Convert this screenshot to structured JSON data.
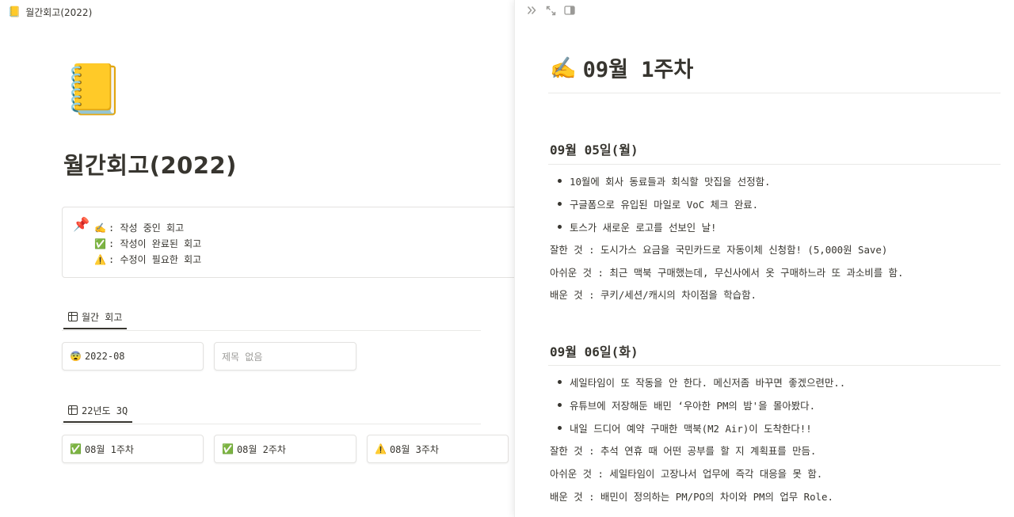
{
  "main": {
    "breadcrumb_icon": "📒",
    "breadcrumb_title": "월간회고(2022)",
    "page_icon": "📒",
    "page_title": "월간회고(2022)",
    "callout": {
      "icon": "📌",
      "legend": [
        {
          "emoji": "✍️",
          "text": ": 작성 중인 회고"
        },
        {
          "emoji": "✅",
          "text": ": 작성이 완료된 회고"
        },
        {
          "emoji": "⚠️",
          "text": ": 수정이 필요한 회고"
        }
      ]
    },
    "view1": {
      "label": "월간 회고",
      "cards": [
        {
          "emoji": "😨",
          "title": "2022-08"
        },
        {
          "emoji": "",
          "title": "제목 없음"
        }
      ]
    },
    "view2": {
      "label": "22년도 3Q",
      "cards": [
        {
          "emoji": "✅",
          "title": "08월 1주차"
        },
        {
          "emoji": "✅",
          "title": "08월 2주차"
        },
        {
          "emoji": "⚠️",
          "title": "08월 3주차"
        }
      ]
    }
  },
  "peek": {
    "toolbar_icons": [
      "double-chevron-right-icon",
      "expand-icon",
      "panel-toggle-icon"
    ],
    "title_emoji": "✍️",
    "title": "09월 1주차",
    "sections": [
      {
        "heading": "09월 05일(월)",
        "bullets": [
          "10월에 회사 동료들과 회식할 맛집을 선정함.",
          "구글폼으로 유입된 마일로 VoC 체크 완료.",
          "토스가 새로운 로고를 선보인 날!"
        ],
        "lines": [
          "잘한 것 : 도시가스 요금을 국민카드로 자동이체 신청함! (5,000원 Save)",
          "아쉬운 것 : 최근 맥북 구매했는데, 무신사에서 옷 구매하느라 또 과소비를 함.",
          "배운 것 : 쿠키/세션/캐시의 차이점을 학습함."
        ]
      },
      {
        "heading": "09월 06일(화)",
        "bullets": [
          "세일타임이 또 작동을 안 한다. 메신저좀 바꾸면 좋겠으련만..",
          "유튜브에 저장해둔 배민 ‘우아한 PM의 밤'을 몰아봤다.",
          "내일 드디어 예약 구매한 맥북(M2 Air)이 도착한다!!"
        ],
        "lines": [
          "잘한 것 : 추석 연휴 때 어떤 공부를 할 지 계획표를 만듬.",
          "아쉬운 것 : 세일타임이 고장나서 업무에 즉각 대응을 못 함.",
          "배운 것 : 배민이 정의하는 PM/PO의 차이와 PM의 업무 Role."
        ]
      }
    ]
  }
}
